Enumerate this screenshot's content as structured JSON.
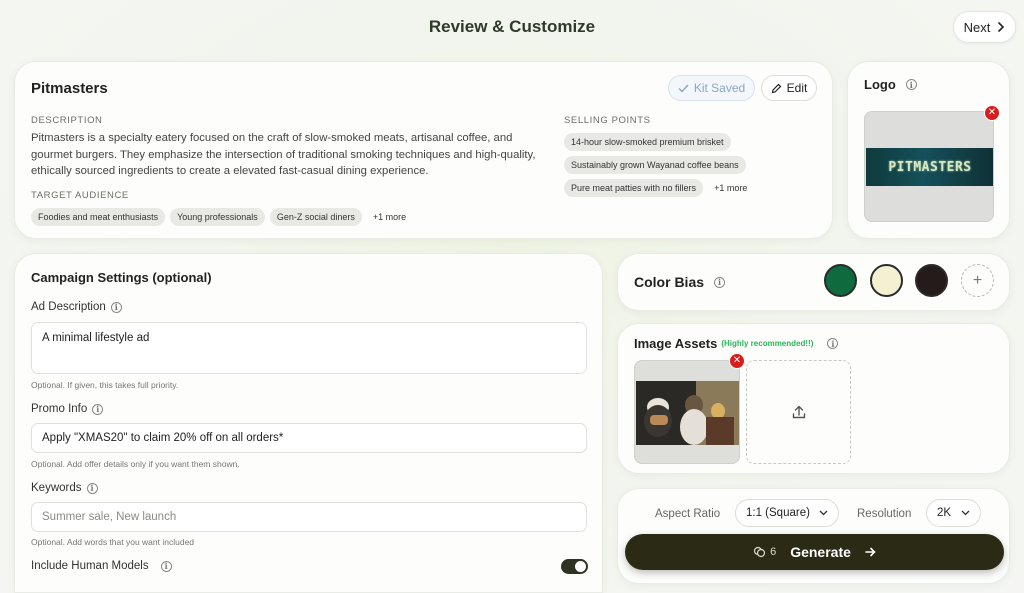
{
  "header": {
    "title": "Review & Customize",
    "next_label": "Next"
  },
  "brand": {
    "name": "Pitmasters",
    "kit_saved_label": "Kit Saved",
    "edit_label": "Edit",
    "description_heading": "DESCRIPTION",
    "description": "Pitmasters is a specialty eatery focused on the craft of slow-smoked meats, artisanal coffee, and gourmet burgers. They emphasize the intersection of traditional smoking techniques and high-quality, ethically sourced ingredients to create a elevated fast-casual dining experience.",
    "audience_heading": "TARGET AUDIENCE",
    "audience": [
      "Foodies and meat enthusiasts",
      "Young professionals",
      "Gen-Z social diners"
    ],
    "audience_more": "+1 more",
    "selling_heading": "SELLING POINTS",
    "selling_points": [
      "14-hour slow-smoked premium brisket",
      "Sustainably grown Wayanad coffee beans",
      "Pure meat patties with no fillers"
    ],
    "selling_more": "+1 more"
  },
  "logo": {
    "title": "Logo",
    "wordmark": "PITMASTERS"
  },
  "campaign": {
    "title": "Campaign Settings (optional)",
    "ad_description": {
      "label": "Ad Description",
      "value": "A minimal lifestyle ad",
      "hint": "Optional. If given, this takes full priority."
    },
    "promo_info": {
      "label": "Promo Info",
      "value": "Apply \"XMAS20\" to claim 20% off on all orders*",
      "hint": "Optional. Add offer details only if you want them shown."
    },
    "keywords": {
      "label": "Keywords",
      "placeholder": "Summer sale, New launch",
      "hint": "Optional. Add words that you want included"
    },
    "human_models": {
      "label": "Include Human Models",
      "enabled": true
    }
  },
  "color_bias": {
    "title": "Color Bias",
    "swatches": [
      {
        "name": "green",
        "color": "#0f6b3d"
      },
      {
        "name": "cream",
        "color": "#f3f1d2"
      },
      {
        "name": "dark-brown",
        "color": "#241b1a"
      }
    ]
  },
  "image_assets": {
    "title": "Image Assets",
    "note": "(Highly recommended!!)"
  },
  "generation": {
    "aspect_ratio_label": "Aspect Ratio",
    "aspect_ratio_value": "1:1 (Square)",
    "resolution_label": "Resolution",
    "resolution_value": "2K",
    "credits": "6",
    "generate_label": "Generate"
  },
  "colors": {
    "accent_dark": "#2b2a15",
    "remove_red": "#d91c1c",
    "highlight_green": "#2bb45a"
  }
}
